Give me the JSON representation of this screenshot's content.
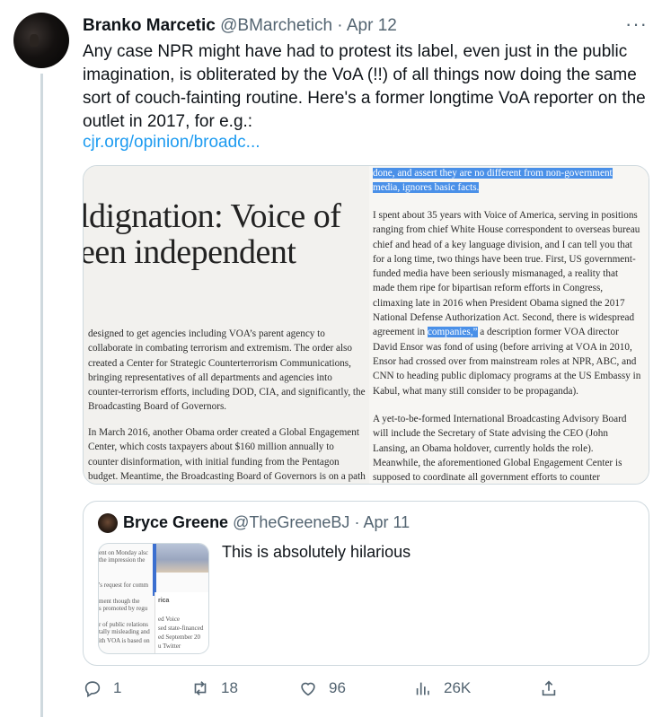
{
  "tweet": {
    "author_name": "Branko Marcetic",
    "handle": "@BMarchetich",
    "separator": " · ",
    "date": "Apr 12",
    "more_label": "···",
    "text": "Any case NPR might have had to protest its label, even just in the public imagination, is obliterated by the VoA (!!) of all things now doing the same sort of couch-fainting routine. Here's a former longtime VoA reporter on the outlet in 2017, for e.g.:",
    "link": "cjr.org/opinion/broadc..."
  },
  "media": {
    "headline_line1": "ldignation: Voice of",
    "headline_line2": "een independent",
    "left_para1": "designed to get agencies including VOA’s parent agency to collaborate in combating terrorism and extremism. The order also created a Center for Strategic Counterterrorism Communications, bringing representatives of all departments and agencies into counter-terrorism efforts, including DOD, CIA, and significantly, the Broadcasting Board of Governors.",
    "left_para2": "In March 2016, another Obama order created a Global Engagement Center, which costs taxpayers about $160 million annually to counter disinformation, with initial funding from the Pentagon budget. Meantime, the Broadcasting Board of Governors is on a path to eventual elimination, to be replaced",
    "right_top_highlight": "done, and assert they are no different from non-government media, ignores basic facts.",
    "right_para1": "I spent about 35 years with Voice of America, serving in positions ranging from chief White House correspondent to overseas bureau chief and head of a key language division, and I can tell you that for a long time, two things have been true. First, US government-funded media have been seriously mismanaged, a reality that made them ripe for bipartisan reform efforts in Congress, climaxing late in 2016 when President Obama signed the 2017 National Defense Authorization Act. Second, there is widespread agreement in",
    "right_para1_highlight": "companies,”",
    "right_para1_tail": " a description former VOA director David Ensor was fond of using (before arriving at VOA in 2010, Ensor had crossed over from mainstream roles at NPR, ABC, and CNN to heading public diplomacy programs at the US Embassy in Kabul, what many still consider to be propaganda).",
    "right_para2": "A yet-to-be-formed International Broadcasting Advisory Board will include the Secretary of State advising the CEO (John Lansing, an Obama holdover, currently holds the role). Meanwhile, the aforementioned Global Engagement Center is supposed to coordinate all government efforts to counter propaganda and disinformation efforts “aimed at undermining"
  },
  "quote": {
    "author_name": "Bryce Greene",
    "handle": "@TheGreeneBJ",
    "separator": " · ",
    "date": "Apr 11",
    "text": "This is absolutely hilarious",
    "thumb_lines": [
      "ent on Monday alsc",
      "the impression the",
      "'s request for comm",
      "ment though the",
      "s promoted by regu",
      "r of public relations",
      "tally misleading and",
      "ith VOA is based on"
    ],
    "thumb_card": [
      "rica",
      "ed Voice",
      "sed state-financed",
      "ed September 20",
      "u Twitter"
    ]
  },
  "actions": {
    "reply_count": "1",
    "retweet_count": "18",
    "like_count": "96",
    "views_count": "26K"
  },
  "colors": {
    "link": "#1d9bf0",
    "secondary_text": "#536471",
    "highlight": "#4a90e8",
    "border": "#cfd9de"
  },
  "icons": [
    "reply-icon",
    "retweet-icon",
    "like-icon",
    "views-icon",
    "share-icon",
    "more-icon"
  ]
}
